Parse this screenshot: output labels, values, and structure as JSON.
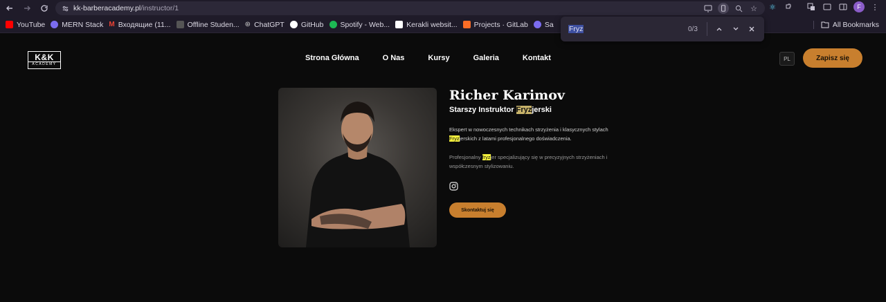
{
  "browser": {
    "url_host": "kk-barberacademy.pl",
    "url_path": "/instructor/1",
    "bookmarks": [
      {
        "label": "YouTube",
        "color": "#ff0000"
      },
      {
        "label": "MERN Stack",
        "color": "#7b6cf0"
      },
      {
        "label": "Входящие (11...",
        "color": "#ea4335"
      },
      {
        "label": "Offline Studen...",
        "color": "#666666"
      },
      {
        "label": "ChatGPT",
        "color": "#cccccc"
      },
      {
        "label": "GitHub",
        "color": "#ffffff"
      },
      {
        "label": "Spotify - Web...",
        "color": "#1db954"
      },
      {
        "label": "Kerakli websit...",
        "color": "#ffffff"
      },
      {
        "label": "Projects · GitLab",
        "color": "#fc6d26"
      },
      {
        "label": "Sa",
        "color": "#7b6cf0"
      }
    ],
    "all_bookmarks": "All Bookmarks",
    "avatar_letter": "F",
    "find": {
      "query": "Fryz",
      "count": "0/3"
    }
  },
  "site": {
    "logo_top": "K&K",
    "logo_bottom": "ACADEMY",
    "nav": [
      "Strona Główna",
      "O Nas",
      "Kursy",
      "Galeria",
      "Kontakt"
    ],
    "lang": "PL",
    "cta": "Zapisz się"
  },
  "instructor": {
    "name": "Richer Karimov",
    "role_pre": "Starszy Instruktor ",
    "role_mark": "Fryz",
    "role_post": "jerski",
    "p1_pre": "Ekspert w nowoczesnych technikach strzyżenia i klasycznych stylach ",
    "p1_mark": "Fryz",
    "p1_post": "jerskich z latami profesjonalnego doświadczenia.",
    "p2_pre": "Profesjonalny ",
    "p2_mark": "fryz",
    "p2_post": "jer specjalizujący się w precyzyjnych strzyżeniach i współczesnym stylizowaniu.",
    "contact": "Skontaktuj się"
  }
}
